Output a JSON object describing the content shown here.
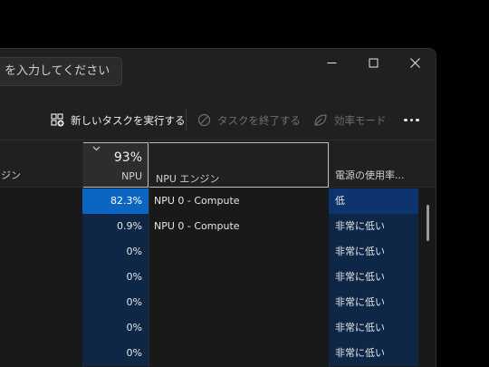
{
  "search": {
    "text": "を入力してください"
  },
  "toolbar": {
    "new_task": "新しいタスクを実行する",
    "end_task": "タスクを終了する",
    "efficiency": "効率モード"
  },
  "columns": {
    "name_partial": "ンジン",
    "npu_percent": "93%",
    "npu_label": "NPU",
    "engine_label": "NPU エンジン",
    "power_label": "電源の使用率..."
  },
  "rows": [
    {
      "npu": "82.3%",
      "engine": "NPU 0 - Compute",
      "power": "低",
      "highlight": true
    },
    {
      "npu": "0.9%",
      "engine": "NPU 0 - Compute",
      "power": "非常に低い",
      "highlight": false
    },
    {
      "npu": "0%",
      "engine": "",
      "power": "非常に低い",
      "highlight": false
    },
    {
      "npu": "0%",
      "engine": "",
      "power": "非常に低い",
      "highlight": false
    },
    {
      "npu": "0%",
      "engine": "",
      "power": "非常に低い",
      "highlight": false
    },
    {
      "npu": "0%",
      "engine": "",
      "power": "非常に低い",
      "highlight": false
    },
    {
      "npu": "0%",
      "engine": "",
      "power": "非常に低い",
      "highlight": false
    }
  ],
  "colors": {
    "accent": "#0b66c2",
    "cell_bg": "#0e2746",
    "window_bg": "#202020"
  }
}
